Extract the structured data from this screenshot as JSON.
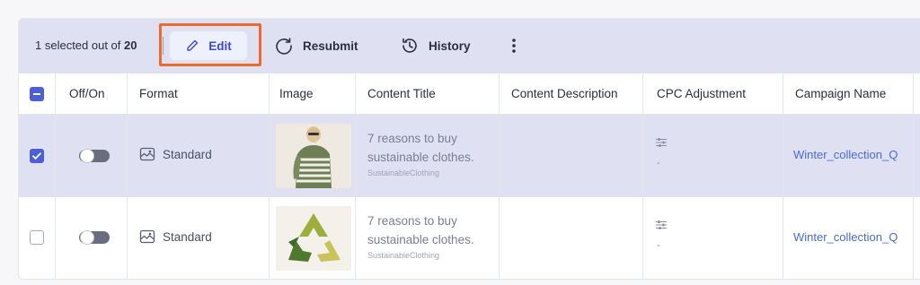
{
  "toolbar": {
    "selected_prefix": "1 selected out of ",
    "selected_total": "20",
    "edit_label": "Edit",
    "resubmit_label": "Resubmit",
    "history_label": "History",
    "more_icon": "more-vertical-icon"
  },
  "columns": {
    "offon": "Off/On",
    "format": "Format",
    "image": "Image",
    "content_title": "Content Title",
    "content_description": "Content Description",
    "cpc_adjustment": "CPC Adjustment",
    "campaign_name": "Campaign Name"
  },
  "rows": [
    {
      "selected": true,
      "format": "Standard",
      "title": "7 reasons to buy sustainable clothes.",
      "brand": "SustainableClothing",
      "description": "",
      "cpc": "-",
      "campaign": "Winter_collection_Q"
    },
    {
      "selected": false,
      "format": "Standard",
      "title": "7 reasons to buy sustainable clothes.",
      "brand": "SustainableClothing",
      "description": "",
      "cpc": "-",
      "campaign": "Winter_collection_Q"
    }
  ],
  "colors": {
    "accent": "#4d5fd6",
    "toolbar_bg": "#dfe1f3",
    "highlight": "#ec6a2c",
    "link": "#4a6ad6"
  }
}
